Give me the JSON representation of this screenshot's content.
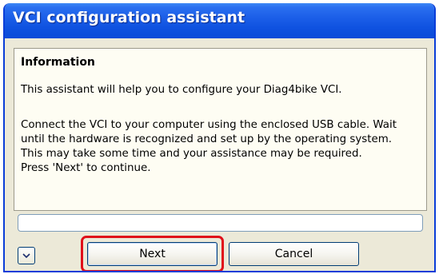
{
  "window": {
    "title": "VCI configuration assistant"
  },
  "info_panel": {
    "heading": "Information",
    "intro": "This assistant will help you to configure your Diag4bike VCI.",
    "body_lines": [
      "Connect the VCI to your computer using the enclosed USB cable. Wait",
      "until the hardware is recognized and set up by the operating system.",
      "This may take some time and your assistance may be required.",
      "Press 'Next' to continue."
    ]
  },
  "progress": {
    "value_percent": 0
  },
  "buttons": {
    "expand_icon": "chevron-down-icon",
    "next_label": "Next",
    "cancel_label": "Cancel"
  },
  "colors": {
    "titlebar": "#0b4bd8",
    "window_bg": "#ece9d8",
    "panel_bg": "#fefdf3",
    "highlight": "#e0101a",
    "button_border": "#003c74"
  }
}
